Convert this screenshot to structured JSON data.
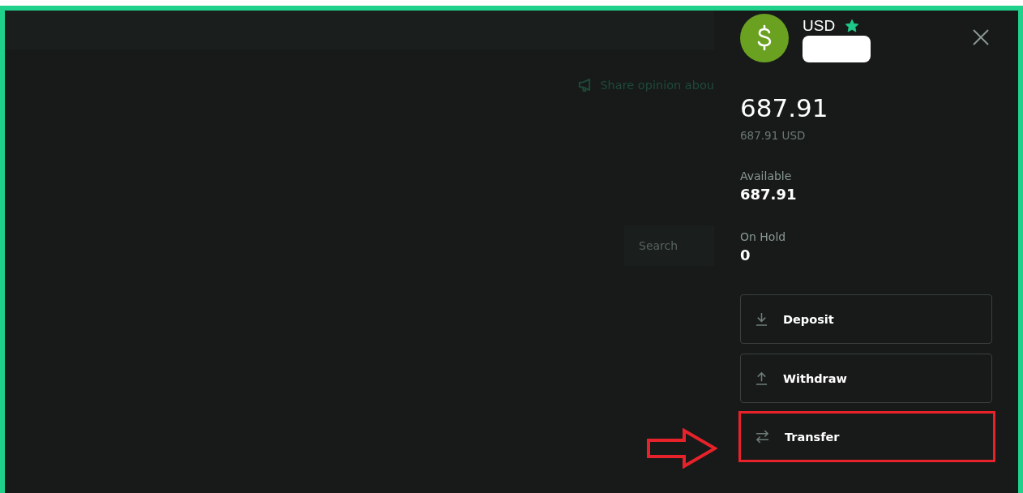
{
  "background": {
    "feedback_link": "Share opinion abou",
    "search": {
      "placeholder": "Search"
    }
  },
  "panel": {
    "currency": "USD",
    "favorite": true,
    "name_redacted": true,
    "balance": "687.91",
    "balance_converted": "687.91 USD",
    "available": {
      "label": "Available",
      "value": "687.91"
    },
    "on_hold": {
      "label": "On Hold",
      "value": "0"
    },
    "actions": [
      {
        "kind": "deposit",
        "label": "Deposit",
        "highlighted": false
      },
      {
        "kind": "withdraw",
        "label": "Withdraw",
        "highlighted": false
      },
      {
        "kind": "transfer",
        "label": "Transfer",
        "highlighted": true
      }
    ]
  }
}
